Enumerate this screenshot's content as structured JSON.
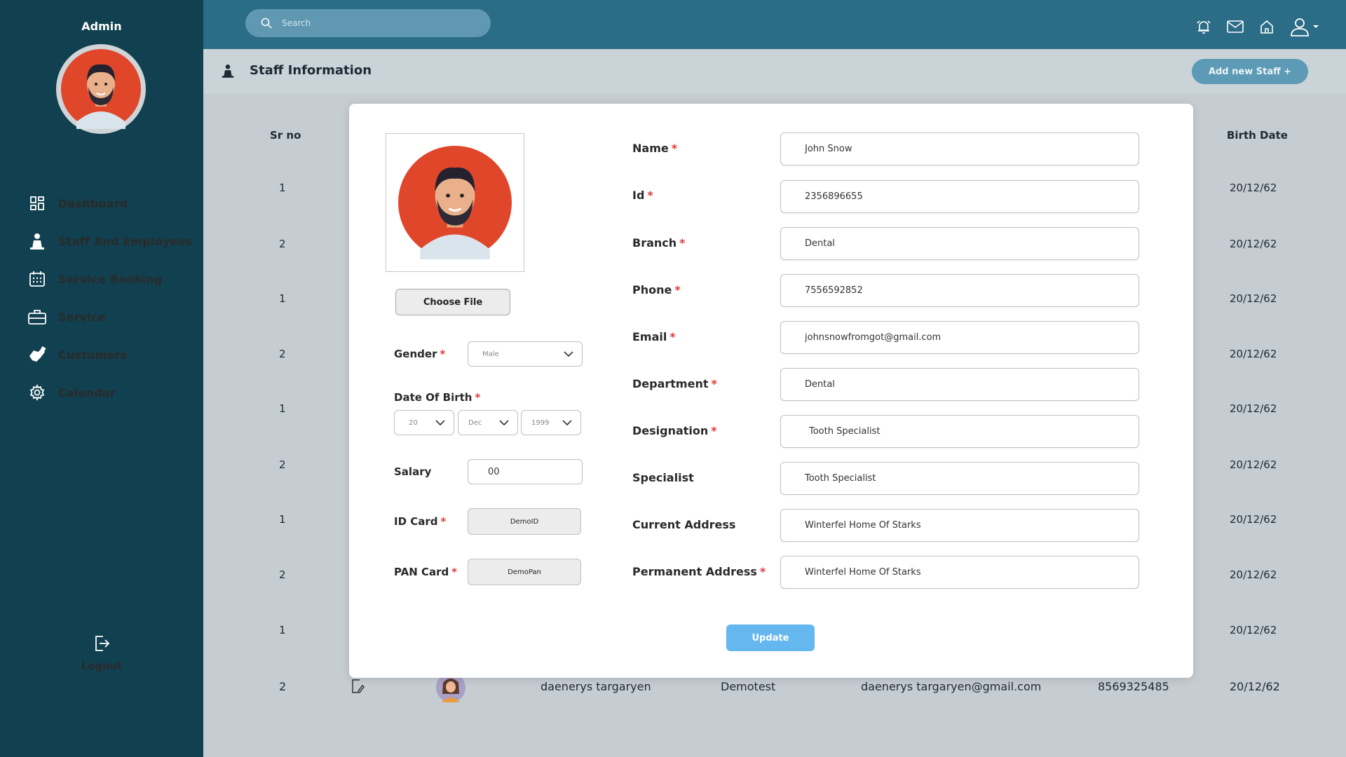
{
  "sidebar": {
    "user_label": "Admin",
    "nav_items": [
      {
        "label": "Dashboard",
        "icon": "dashboard-icon"
      },
      {
        "label": "Staff And Employees",
        "icon": "staff-icon"
      },
      {
        "label": "Service Booking",
        "icon": "calendar-grid-icon"
      },
      {
        "label": "Service",
        "icon": "briefcase-icon"
      },
      {
        "label": "Custumers",
        "icon": "handshake-icon"
      },
      {
        "label": "Calendar",
        "icon": "gear-icon"
      }
    ],
    "logout_label": "Logout"
  },
  "topbar": {
    "search_placeholder": "Search",
    "icons": [
      "alarm-icon",
      "mail-icon",
      "home-icon",
      "user-icon"
    ]
  },
  "page": {
    "title": "Staff Information",
    "add_button": "Add new Staff +"
  },
  "table": {
    "headers": {
      "sr_no": "Sr no",
      "birth_date": "Birth Date"
    },
    "rows": [
      {
        "sr": "1",
        "birth": "20/12/62"
      },
      {
        "sr": "2",
        "birth": "20/12/62"
      },
      {
        "sr": "1",
        "birth": "20/12/62"
      },
      {
        "sr": "2",
        "birth": "20/12/62"
      },
      {
        "sr": "1",
        "birth": "20/12/62"
      },
      {
        "sr": "2",
        "birth": "20/12/62"
      },
      {
        "sr": "1",
        "birth": "20/12/62"
      },
      {
        "sr": "2",
        "birth": "20/12/62"
      },
      {
        "sr": "1",
        "birth": "20/12/62"
      }
    ],
    "last_row": {
      "sr": "2",
      "name": "daenerys targaryen",
      "branch": "Demotest",
      "email": "daenerys targaryen@gmail.com",
      "phone": "8569325485",
      "birth": "20/12/62"
    }
  },
  "form": {
    "choose_file": "Choose File",
    "gender": {
      "label": "Gender",
      "value": "Male"
    },
    "dob": {
      "label": "Date Of Birth",
      "day": "20",
      "month": "Dec",
      "year": "1999"
    },
    "salary": {
      "label": "Salary",
      "value": "00"
    },
    "id_card": {
      "label": "ID Card",
      "value": "DemoID"
    },
    "pan_card": {
      "label": "PAN Card",
      "value": "DemoPan"
    },
    "fields": {
      "name": {
        "label": "Name",
        "value": "John Snow"
      },
      "id": {
        "label": "Id",
        "value": "2356896655"
      },
      "branch": {
        "label": "Branch",
        "value": "Dental"
      },
      "phone": {
        "label": "Phone",
        "value": "7556592852"
      },
      "email": {
        "label": "Email",
        "value": "johnsnowfromgot@gmail.com"
      },
      "department": {
        "label": "Department",
        "value": "Dental"
      },
      "designation": {
        "label": "Designation",
        "value": "Tooth Specialist"
      },
      "specialist": {
        "label": "Specialist",
        "value": "Tooth Specialist"
      },
      "current_address": {
        "label": "Current Address",
        "value": "Winterfel Home Of Starks"
      },
      "permanent_address": {
        "label": "Permanent Address",
        "value": "Winterfel Home Of Starks"
      }
    },
    "required_mark": "*",
    "update_button": "Update"
  },
  "colors": {
    "sidebar_bg": "#114050",
    "topbar_bg": "#2b6c87",
    "update_button": "#65b7ef",
    "required": "#e03a3a"
  }
}
